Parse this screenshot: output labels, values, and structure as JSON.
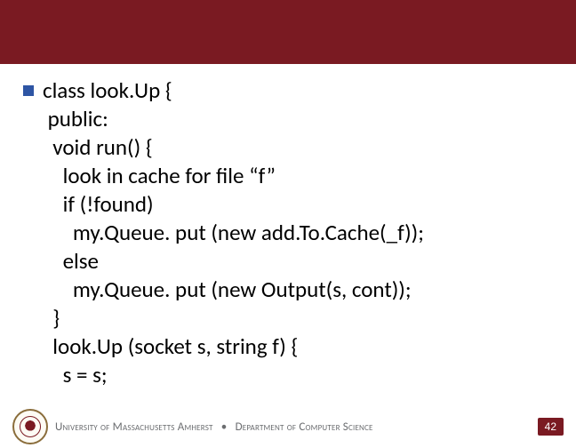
{
  "header": {
    "title": ""
  },
  "slide": {
    "code_lines": [
      "class look.Up {",
      " public:",
      "  void run() {",
      "    look in cache for file “f”",
      "    if (!found)",
      "      my.Queue. put (new add.To.Cache(_f));",
      "    else",
      "      my.Queue. put (new Output(s, cont));",
      "  }",
      "  look.Up (socket s, string f) {",
      "    s = s;"
    ]
  },
  "footer": {
    "institution": "University of Massachusetts Amherst",
    "separator": "•",
    "department": "Department of Computer Science",
    "page_number": "42"
  },
  "icons": {
    "bullet": "square-bullet-icon",
    "seal": "umass-seal-icon"
  },
  "colors": {
    "brand": "#7a1a22",
    "bullet": "#2e55a4",
    "footer_text": "#6b6d70"
  }
}
